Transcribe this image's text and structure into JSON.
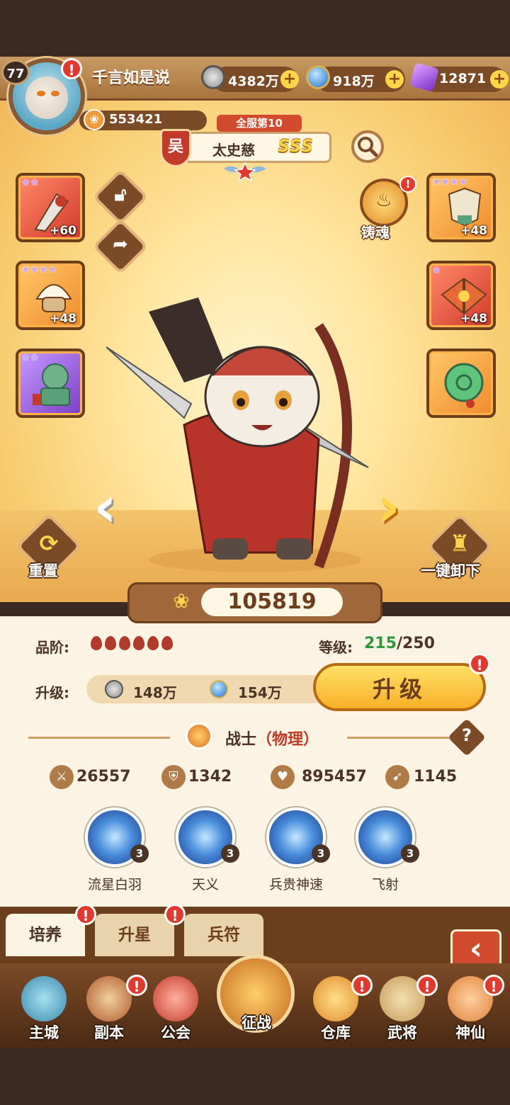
{
  "player": {
    "level": "77",
    "name": "千言如是说",
    "power": "553421"
  },
  "resources": [
    {
      "icon": "coin-icon",
      "value": "4382万"
    },
    {
      "icon": "blue-orb-icon",
      "value": "918万"
    },
    {
      "icon": "purple-crystal-icon",
      "value": "12871"
    }
  ],
  "hero": {
    "rank": "全服第10",
    "kingdom": "吴",
    "name": "太史慈",
    "grade": "SSS",
    "combat_power": "105819"
  },
  "equipment_left": [
    {
      "level": "+60",
      "rarity": "red",
      "stars": 2
    },
    {
      "level": "+48",
      "rarity": "orange",
      "stars": 4
    },
    {
      "level": "",
      "rarity": "purple",
      "stars": 2
    }
  ],
  "equipment_right": [
    {
      "level": "+48",
      "rarity": "orange",
      "stars": 4
    },
    {
      "level": "+48",
      "rarity": "red",
      "stars": 1
    },
    {
      "level": "",
      "rarity": "orange",
      "stars": 0
    }
  ],
  "actions": {
    "forge_label": "铸魂",
    "reset_label": "重置",
    "unequip_label": "一键卸下",
    "upgrade_label": "升级"
  },
  "info": {
    "quality_label": "品阶:",
    "quality_count": 6,
    "level_label": "等级:",
    "level_current": "215",
    "level_max": "/250",
    "upgrade_cost_label": "升级:",
    "cost_coin": "148万",
    "cost_orb": "154万",
    "class_name": "战士",
    "class_type": "（物理）"
  },
  "stats": [
    {
      "icon": "sword-icon",
      "value": "26557"
    },
    {
      "icon": "shield-icon",
      "value": "1342"
    },
    {
      "icon": "heart-icon",
      "value": "895457"
    },
    {
      "icon": "boot-icon",
      "value": "1145"
    }
  ],
  "skills": [
    {
      "name": "流星白羽",
      "level": "3"
    },
    {
      "name": "天义",
      "level": "3"
    },
    {
      "name": "兵贵神速",
      "level": "3"
    },
    {
      "name": "飞射",
      "level": "3"
    }
  ],
  "tabs": [
    {
      "label": "培养",
      "active": true
    },
    {
      "label": "升星",
      "active": false
    },
    {
      "label": "兵符",
      "active": false
    }
  ],
  "nav": [
    {
      "label": "主城",
      "icon": "city-icon"
    },
    {
      "label": "副本",
      "icon": "sword-shield-icon"
    },
    {
      "label": "公会",
      "icon": "flag-icon"
    },
    {
      "label": "征战",
      "icon": "battle-icon"
    },
    {
      "label": "仓库",
      "icon": "bag-icon"
    },
    {
      "label": "武将",
      "icon": "cat-general-icon"
    },
    {
      "label": "神仙",
      "icon": "cat-immortal-icon"
    }
  ],
  "colors": {
    "accent": "#f8b02a",
    "level_green": "#2c9a3a",
    "class_red": "#c43a2a",
    "alert": "#e4372d"
  }
}
